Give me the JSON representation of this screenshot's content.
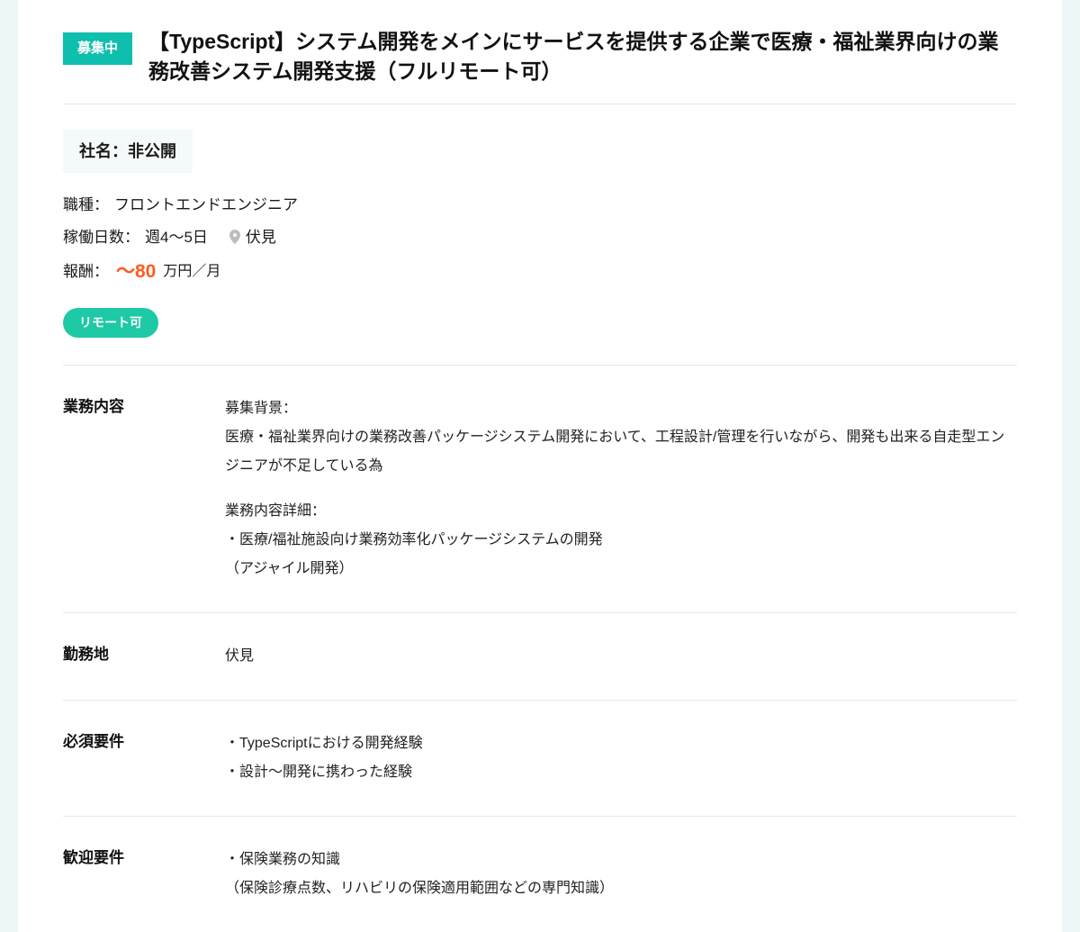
{
  "header": {
    "status": "募集中",
    "title": "【TypeScript】システム開発をメインにサービスを提供する企業で医療・福祉業界向けの業務改善システム開発支援（フルリモート可）"
  },
  "summary": {
    "company_label": "社名：",
    "company_value": "非公開",
    "role_label": "職種：",
    "role_value": "フロントエンドエンジニア",
    "days_label": "稼働日数：",
    "days_value": "週4〜5日",
    "location": "伏見",
    "salary_label": "報酬：",
    "salary_amount": "〜80",
    "salary_unit": "万円／月",
    "remote_tag": "リモート可"
  },
  "sections": {
    "work": {
      "label": "業務内容",
      "bg_heading": "募集背景：",
      "bg_body": "医療・福祉業界向けの業務改善パッケージシステム開発において、工程設計/管理を行いながら、開発も出来る自走型エンジニアが不足している為",
      "detail_heading": "業務内容詳細：",
      "detail_line1": "・医療/福祉施設向け業務効率化パッケージシステムの開発",
      "detail_line2": "（アジャイル開発）"
    },
    "location": {
      "label": "勤務地",
      "value": "伏見"
    },
    "required": {
      "label": "必須要件",
      "line1": "・TypeScriptにおける開発経験",
      "line2": "・設計〜開発に携わった経験"
    },
    "welcome": {
      "label": "歓迎要件",
      "line1": "・保険業務の知識",
      "line2": "（保険診療点数、リハビリの保険適用範囲などの専門知識）"
    }
  }
}
